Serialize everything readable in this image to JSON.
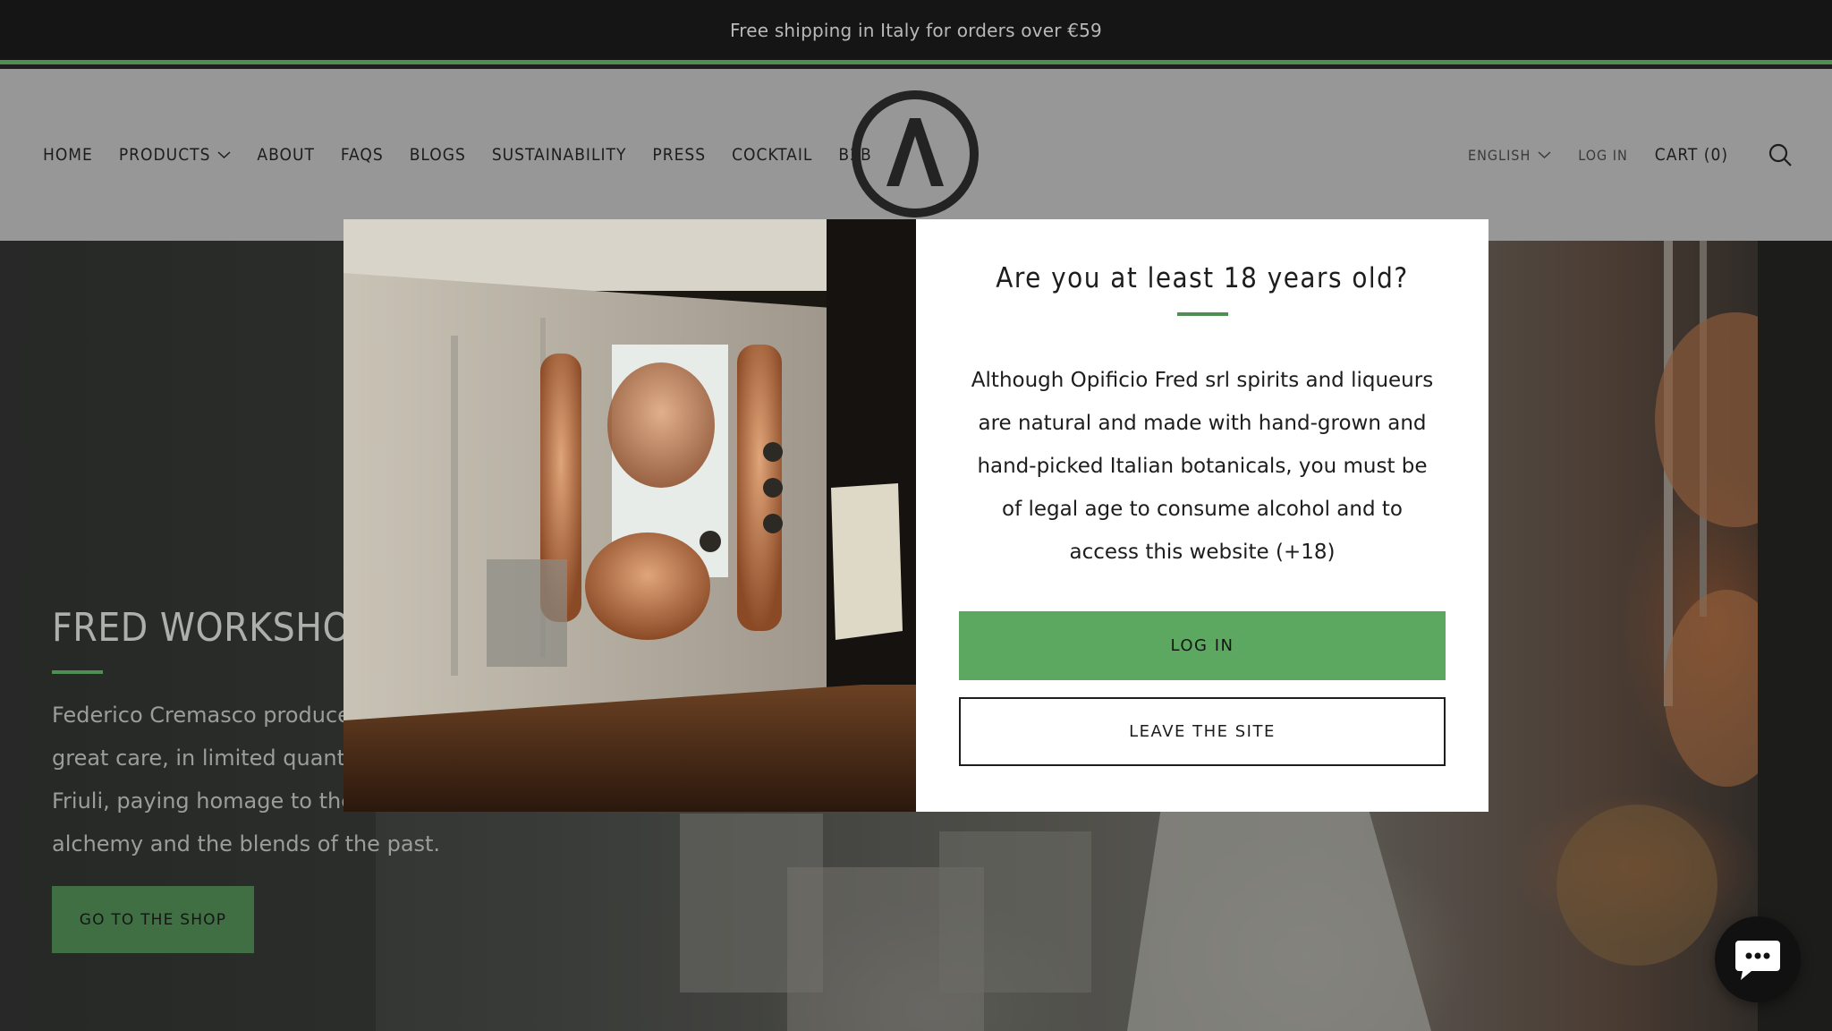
{
  "announcement": {
    "text": "Free shipping in Italy for orders over €59"
  },
  "nav": {
    "items": [
      {
        "label": "HOME"
      },
      {
        "label": "PRODUCTS"
      },
      {
        "label": "ABOUT"
      },
      {
        "label": "FAQS"
      },
      {
        "label": "BLOGS"
      },
      {
        "label": "SUSTAINABILITY"
      },
      {
        "label": "PRESS"
      },
      {
        "label": "COCKTAIL"
      },
      {
        "label": "B2B"
      }
    ],
    "language": "ENGLISH",
    "login": "LOG IN",
    "cart": "CART (0)"
  },
  "hero": {
    "title": "FRED WORKSHOP",
    "description": "Federico Cremasco produces... great care, in limited quantities... Friuli, paying homage to the... alchemy and the blends of the past.",
    "description_lines": [
      "Federico Cremasco produces",
      "great care, in limited quantiti",
      "Friuli, paying homage to the",
      "alchemy and the blends of the past."
    ],
    "button": "GO TO THE SHOP"
  },
  "modal": {
    "title": "Are you at least 18 years old?",
    "text": "Although Opificio Fred srl spirits and liqueurs are natural and made with hand-grown and hand-picked Italian botanicals, you must be of legal age to consume alcohol and to access this website (+18)",
    "login_button": "LOG IN",
    "leave_button": "LEAVE THE SITE"
  },
  "colors": {
    "accent": "#5ca860",
    "header_bg": "#979797",
    "announcement_bg": "#151515"
  }
}
